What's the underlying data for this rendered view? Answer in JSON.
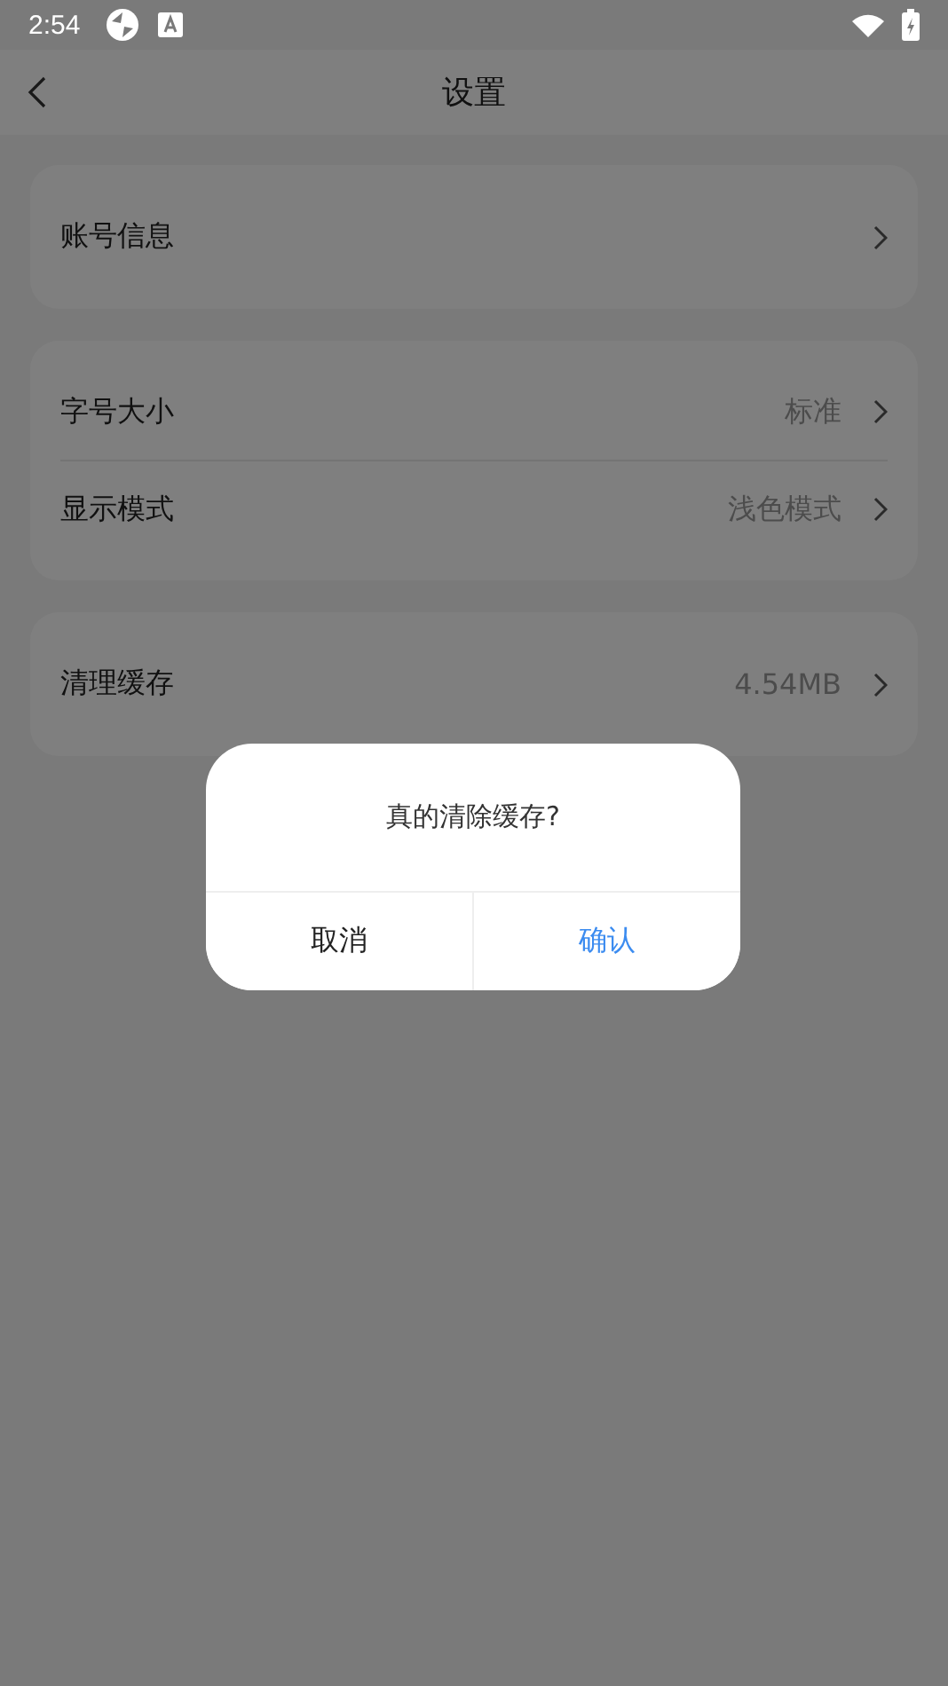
{
  "status_bar": {
    "time": "2:54"
  },
  "header": {
    "title": "设置"
  },
  "groups": [
    {
      "items": [
        {
          "label": "账号信息"
        }
      ]
    },
    {
      "items": [
        {
          "label": "字号大小",
          "value": "标准"
        },
        {
          "label": "显示模式",
          "value": "浅色模式"
        }
      ]
    },
    {
      "items": [
        {
          "label": "清理缓存",
          "value": "4.54MB"
        }
      ]
    }
  ],
  "dialog": {
    "message": "真的清除缓存?",
    "buttons": [
      {
        "label": "取消",
        "kind": "cancel"
      },
      {
        "label": "确认",
        "kind": "confirm"
      }
    ]
  }
}
